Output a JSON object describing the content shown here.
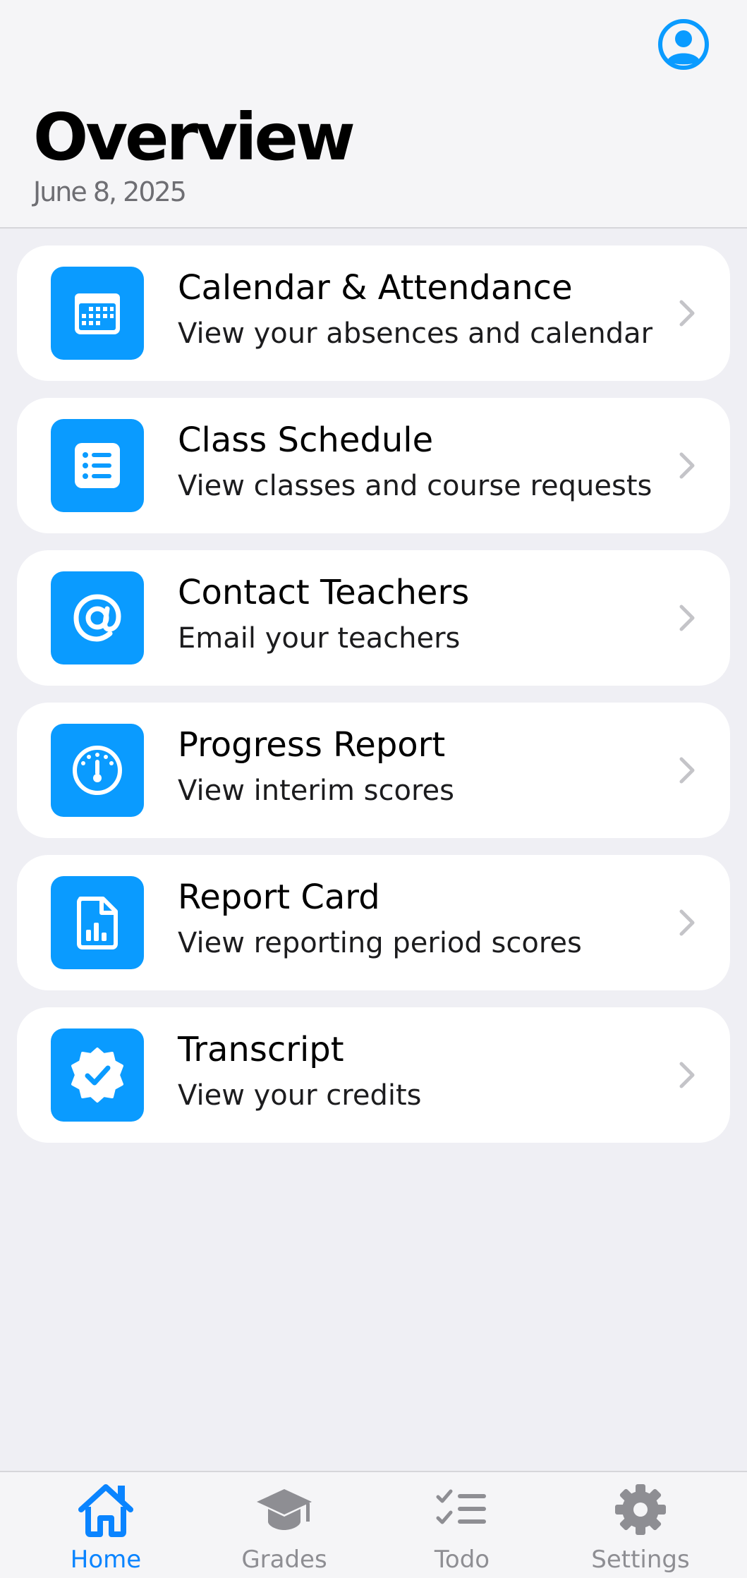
{
  "header": {
    "title": "Overview",
    "date": "June 8, 2025",
    "profile_icon": "person-circle-icon"
  },
  "colors": {
    "accent": "#0a9bff",
    "tab_active": "#0a84ff",
    "tab_inactive": "#8e8e93",
    "background": "#efeff4"
  },
  "menu": {
    "items": [
      {
        "title": "Calendar & Attendance",
        "subtitle": "View your absences and calendar",
        "icon": "calendar-icon"
      },
      {
        "title": "Class Schedule",
        "subtitle": "View classes and course requests",
        "icon": "list-icon"
      },
      {
        "title": "Contact Teachers",
        "subtitle": "Email your teachers",
        "icon": "at-sign-icon"
      },
      {
        "title": "Progress Report",
        "subtitle": "View interim scores",
        "icon": "gauge-icon"
      },
      {
        "title": "Report Card",
        "subtitle": "View reporting period scores",
        "icon": "document-chart-icon"
      },
      {
        "title": "Transcript",
        "subtitle": "View your credits",
        "icon": "checkmark-seal-icon"
      }
    ]
  },
  "tabbar": {
    "active": "Home",
    "tabs": [
      {
        "label": "Home",
        "icon": "house-icon"
      },
      {
        "label": "Grades",
        "icon": "graduation-cap-icon"
      },
      {
        "label": "Todo",
        "icon": "checklist-icon"
      },
      {
        "label": "Settings",
        "icon": "gear-icon"
      }
    ]
  }
}
